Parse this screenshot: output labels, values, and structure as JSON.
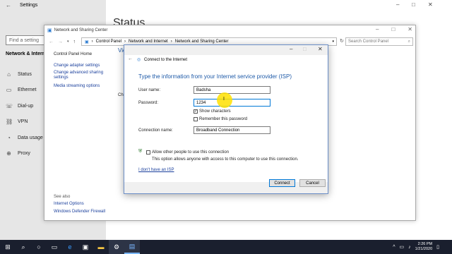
{
  "settings": {
    "title": "Settings",
    "main_title": "Status",
    "search_placeholder": "Find a setting",
    "section": "Network & Internet",
    "nav": [
      {
        "label": "Status",
        "icon": "home-icon"
      },
      {
        "label": "Ethernet",
        "icon": "ethernet-icon"
      },
      {
        "label": "Dial-up",
        "icon": "dialup-icon"
      },
      {
        "label": "VPN",
        "icon": "vpn-icon"
      },
      {
        "label": "Data usage",
        "icon": "data-usage-icon"
      },
      {
        "label": "Proxy",
        "icon": "globe-icon"
      }
    ]
  },
  "nsc": {
    "title": "Network and Sharing Center",
    "breadcrumb": [
      "Control Panel",
      "Network and Internet",
      "Network and Sharing Center"
    ],
    "search_placeholder": "Search Control Panel",
    "home": "Control Panel Home",
    "links": [
      "Change adapter settings",
      "Change advanced sharing settings",
      "Media streaming options"
    ],
    "see_also": "See also",
    "see_also_links": [
      "Internet Options",
      "Windows Defender Firewall"
    ],
    "partial_view": "Vie",
    "partial_change": "Cha"
  },
  "dialog": {
    "title": "Connect to the Internet",
    "heading": "Type the information from your Internet service provider (ISP)",
    "username_label": "User name:",
    "username_value": "Badsha",
    "password_label": "Password:",
    "password_value": "1234",
    "show_chars": "Show characters",
    "remember": "Remember this password",
    "conn_name_label": "Connection name:",
    "conn_name_value": "Broadband Connection",
    "allow_others": "Allow other people to use this connection",
    "allow_desc": "This option allows anyone with access to this computer to use this connection.",
    "no_isp": "I don't have an ISP",
    "connect": "Connect",
    "cancel": "Cancel"
  },
  "taskbar": {
    "time": "2:26 PM",
    "date": "1/21/2020"
  },
  "colors": {
    "accent": "#0078d7",
    "link": "#1a3f9c",
    "heading": "#1e5aa8",
    "cursor_highlight": "#ffe000"
  }
}
